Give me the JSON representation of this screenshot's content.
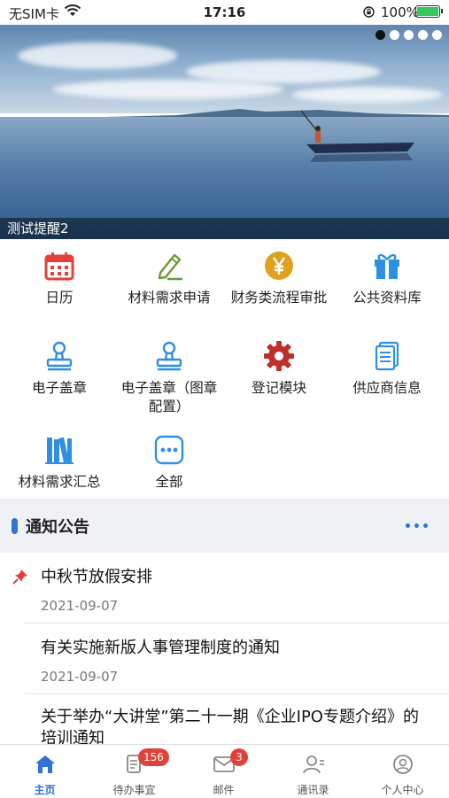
{
  "status_bar": {
    "carrier": "无SIM卡",
    "time": "17:16",
    "battery": "100%"
  },
  "banner": {
    "caption": "测试提醒2",
    "slide_count": 5,
    "active_slide": 1
  },
  "apps": [
    {
      "label": "日历",
      "icon": "calendar-icon",
      "color": "#e0423a"
    },
    {
      "label": "材料需求申请",
      "icon": "pencil-edit-icon",
      "color": "#6a9a3a"
    },
    {
      "label": "财务类流程审批",
      "icon": "yen-coin-icon",
      "color": "#e0a020"
    },
    {
      "label": "公共资料库",
      "icon": "gift-box-icon",
      "color": "#2f8fe0"
    },
    {
      "label": "电子盖章",
      "icon": "stamp-icon",
      "color": "#2f8fe0"
    },
    {
      "label": "电子盖章（图章配置）",
      "icon": "stamp-config-icon",
      "color": "#2f8fe0"
    },
    {
      "label": "登记模块",
      "icon": "gear-icon",
      "color": "#c0302a"
    },
    {
      "label": "供应商信息",
      "icon": "document-stack-icon",
      "color": "#2f8fe0"
    },
    {
      "label": "材料需求汇总",
      "icon": "books-icon",
      "color": "#2f8fe0"
    },
    {
      "label": "全部",
      "icon": "more-apps-icon",
      "color": "#2f8fe0"
    }
  ],
  "notices": {
    "title": "通知公告",
    "items": [
      {
        "title": "中秋节放假安排",
        "date": "2021-09-07",
        "pinned": true
      },
      {
        "title": "有关实施新版人事管理制度的通知",
        "date": "2021-09-07",
        "pinned": false
      },
      {
        "title": "关于举办“大讲堂”第二十一期《企业IPO专题介绍》的培训通知",
        "date": "",
        "pinned": false
      }
    ]
  },
  "tabs": [
    {
      "label": "主页",
      "icon": "home-icon",
      "active": true,
      "badge": ""
    },
    {
      "label": "待办事宜",
      "icon": "todo-icon",
      "active": false,
      "badge": "156"
    },
    {
      "label": "邮件",
      "icon": "mail-icon",
      "active": false,
      "badge": "3"
    },
    {
      "label": "通讯录",
      "icon": "contacts-icon",
      "active": false,
      "badge": ""
    },
    {
      "label": "个人中心",
      "icon": "profile-icon",
      "active": false,
      "badge": ""
    }
  ],
  "colors": {
    "accent": "#2f72d8",
    "badge": "#e0423a"
  }
}
